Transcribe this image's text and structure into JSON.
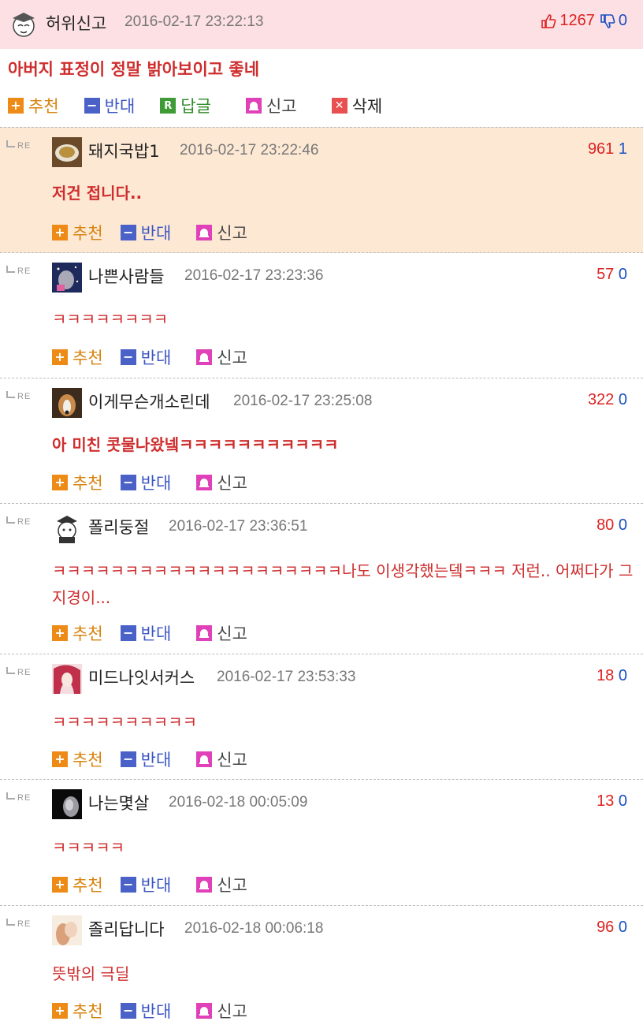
{
  "post": {
    "nick": "허위신고",
    "date": "2016-02-17 23:22:13",
    "up": "1267",
    "down": "0",
    "message": "아버지 표정이 정말 밝아보이고 좋네",
    "actions": {
      "recommend": "추천",
      "oppose": "반대",
      "reply": "답글",
      "report": "신고",
      "delete": "삭제"
    }
  },
  "re_label": "RE",
  "actions": {
    "recommend": "추천",
    "oppose": "반대",
    "report": "신고"
  },
  "replies": [
    {
      "nick": "돼지국밥1",
      "date": "2016-02-17 23:22:46",
      "up": "961",
      "down": "1",
      "message": "저건 접니다.."
    },
    {
      "nick": "나쁜사람들",
      "date": "2016-02-17 23:23:36",
      "up": "57",
      "down": "0",
      "message": "ㅋㅋㅋㅋㅋㅋㅋㅋ"
    },
    {
      "nick": "이게무슨개소린데",
      "date": "2016-02-17 23:25:08",
      "up": "322",
      "down": "0",
      "message": "아 미친 콧물나왔넼ㅋㅋㅋㅋㅋㅋㅋㅋㅋㅋㅋ"
    },
    {
      "nick": "폴리둥절",
      "date": "2016-02-17 23:36:51",
      "up": "80",
      "down": "0",
      "message": "ㅋㅋㅋㅋㅋㅋㅋㅋㅋㅋㅋㅋㅋㅋㅋㅋㅋㅋㅋㅋ나도 이생각했는뎈ㅋㅋㅋ 저런.. 어쩌다가 그 지경이..."
    },
    {
      "nick": "미드나잇서커스",
      "date": "2016-02-17 23:53:33",
      "up": "18",
      "down": "0",
      "message": "ㅋㅋㅋㅋㅋㅋㅋㅋㅋㅋ"
    },
    {
      "nick": "나는몇살",
      "date": "2016-02-18 00:05:09",
      "up": "13",
      "down": "0",
      "message": "ㅋㅋㅋㅋㅋ"
    },
    {
      "nick": "졸리답니다",
      "date": "2016-02-18 00:06:18",
      "up": "96",
      "down": "0",
      "message": "뜻밖의 극딜"
    }
  ]
}
